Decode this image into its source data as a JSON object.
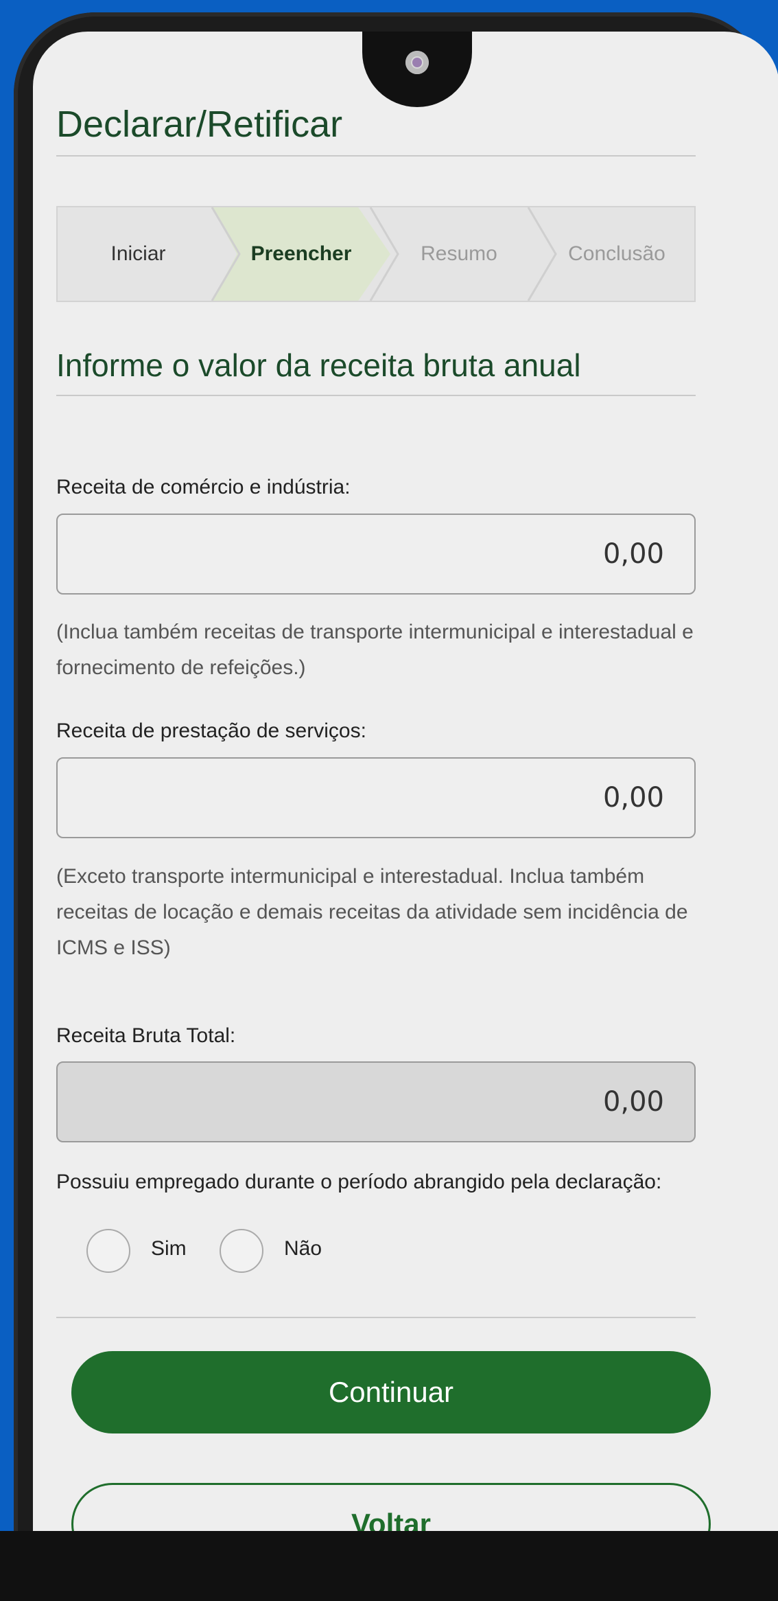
{
  "statusbar": {
    "left": "",
    "right": ""
  },
  "page_title": "Declarar/Retificar",
  "stepper": {
    "steps": [
      {
        "label": "Iniciar"
      },
      {
        "label": "Preencher"
      },
      {
        "label": "Resumo"
      },
      {
        "label": "Conclusão"
      }
    ],
    "active_index": 1
  },
  "section_title": "Informe o valor da receita bruta anual",
  "fields": {
    "comercio": {
      "label": "Receita de comércio e indústria:",
      "value": "0,00",
      "hint": "(Inclua também receitas de transporte intermunicipal e interestadual e fornecimento de refeições.)"
    },
    "servicos": {
      "label": "Receita de prestação de serviços:",
      "value": "0,00",
      "hint": "(Exceto transporte intermunicipal e interestadual. Inclua também receitas de locação e demais receitas da atividade sem incidência de ICMS e ISS)"
    },
    "total": {
      "label": "Receita Bruta Total:",
      "value": "0,00"
    }
  },
  "empregado": {
    "question": "Possuiu empregado durante o período abrangido pela declaração:",
    "options": [
      {
        "label": "Sim"
      },
      {
        "label": "Não"
      }
    ]
  },
  "buttons": {
    "continue": "Continuar",
    "back": "Voltar"
  },
  "colors": {
    "primary": "#1f6e2c",
    "heading": "#1b4a2a",
    "background": "#0a5fc2"
  }
}
